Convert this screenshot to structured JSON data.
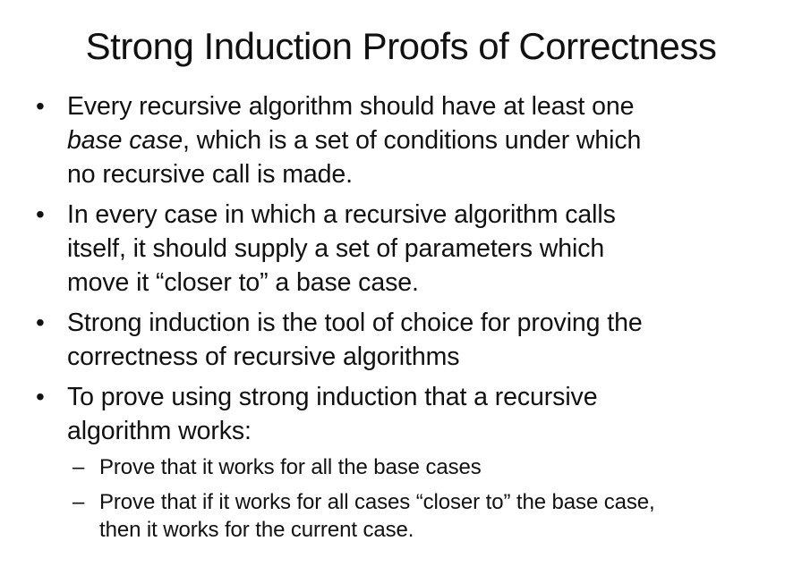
{
  "slide": {
    "title": "Strong Induction Proofs of Correctness",
    "bullet_marker": "•",
    "sub_marker": "–",
    "bullets": [
      {
        "line1": "Every recursive algorithm should have at least one",
        "line2_em": "base case",
        "line2_rest": ", which is a set of conditions under which",
        "line3": "no recursive call is made."
      },
      {
        "line1": "In every case in which a recursive algorithm calls",
        "line2": "itself, it should supply a set of parameters which",
        "line3": "move it “closer to” a base case."
      },
      {
        "line1": "Strong induction is the tool of choice for proving the",
        "line2": "correctness of recursive algorithms"
      },
      {
        "line1": "To prove using strong induction that a recursive",
        "line2": "algorithm works:",
        "subs": [
          {
            "line1": "Prove that it works for all the base cases"
          },
          {
            "line1": "Prove that if it works for all cases “closer to” the base case,",
            "line2": "then it works for the current case."
          }
        ]
      }
    ]
  }
}
